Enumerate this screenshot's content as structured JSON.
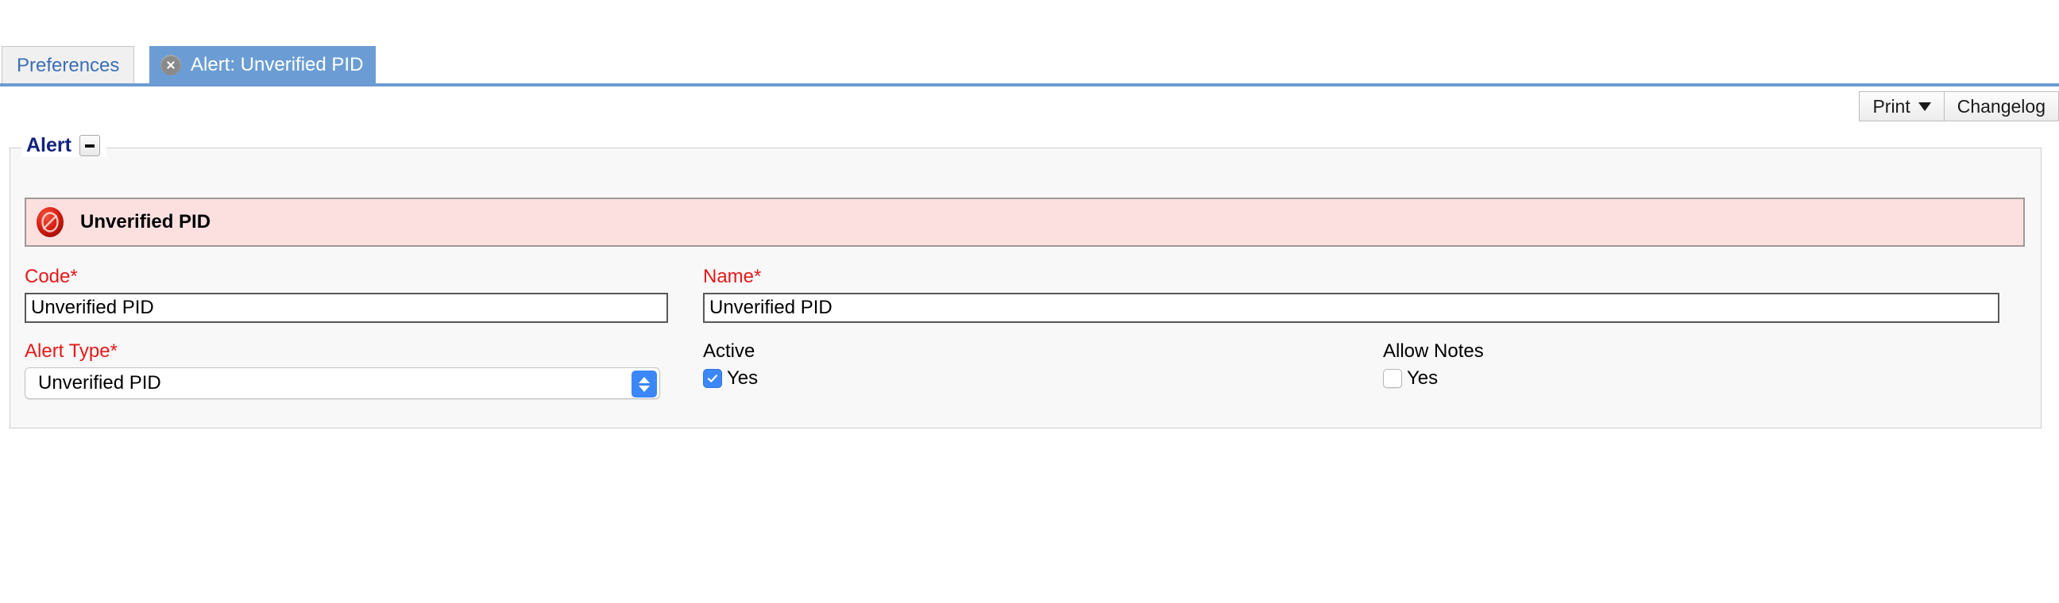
{
  "tabs": [
    {
      "label": "Preferences",
      "active": false,
      "closable": false
    },
    {
      "label": "Alert: Unverified PID",
      "active": true,
      "closable": true,
      "close_icon": "close-circle-icon"
    }
  ],
  "toolbar": {
    "print_label": "Print",
    "print_caret_icon": "caret-down-icon",
    "changelog_label": "Changelog"
  },
  "panel": {
    "legend": "Alert",
    "collapse_icon": "minus-icon"
  },
  "alert_banner": {
    "icon": "prohibition-sign-icon",
    "title": "Unverified PID",
    "background": "#fce0e0",
    "border": "#a09898"
  },
  "form": {
    "code": {
      "label": "Code",
      "required": true,
      "required_marker": "*",
      "value": "Unverified PID",
      "placeholder": ""
    },
    "name": {
      "label": "Name",
      "required": true,
      "required_marker": "*",
      "value": "Unverified PID",
      "placeholder": ""
    },
    "alert_type": {
      "label": "Alert Type",
      "required": true,
      "required_marker": "*",
      "value": "Unverified PID",
      "options": [
        "Unverified PID"
      ]
    },
    "active": {
      "label": "Active",
      "checkbox_label": "Yes",
      "checked": true
    },
    "allow_notes": {
      "label": "Allow Notes",
      "checkbox_label": "Yes",
      "checked": false
    }
  },
  "colors": {
    "tab_active_bg": "#6b9dd4",
    "tab_inactive_text": "#3b6fb6",
    "tab_underline": "#6c9bd0",
    "legend_text": "#13227c",
    "required_label": "#e51919",
    "accent_blue": "#3b87f7",
    "panel_bg": "#f8f8f8"
  }
}
